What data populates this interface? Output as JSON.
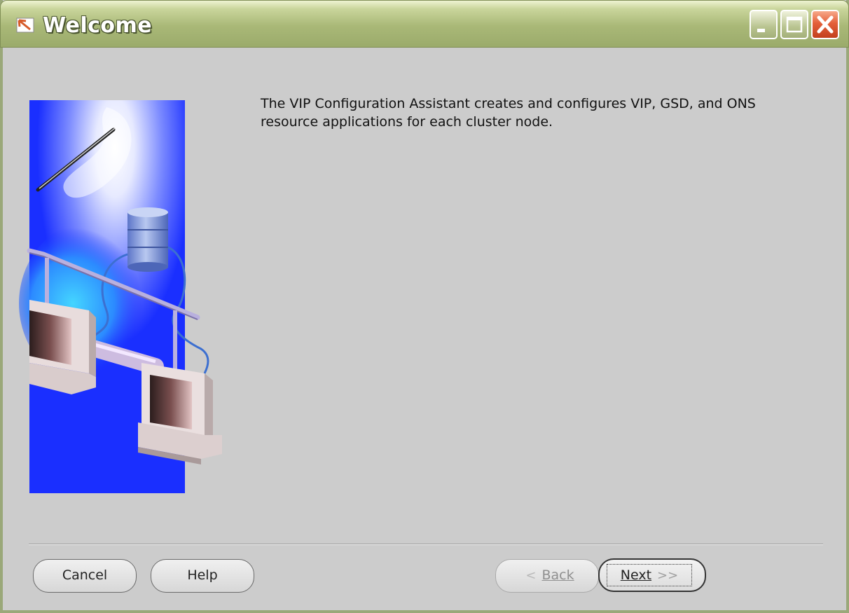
{
  "window": {
    "title": "Welcome",
    "controls": {
      "minimize": "minimize-icon",
      "maximize": "maximize-icon",
      "close": "close-icon"
    }
  },
  "description": "The VIP Configuration Assistant creates and configures VIP, GSD, and ONS resource applications for each cluster node.",
  "buttons": {
    "cancel_label": "Cancel",
    "help_label": "Help",
    "back_label": "Back",
    "next_label": "Next"
  },
  "colors": {
    "titlebar": "#a9b877",
    "close": "#e4603a",
    "panel": "#cccccc",
    "banner": "#1a2fff"
  }
}
